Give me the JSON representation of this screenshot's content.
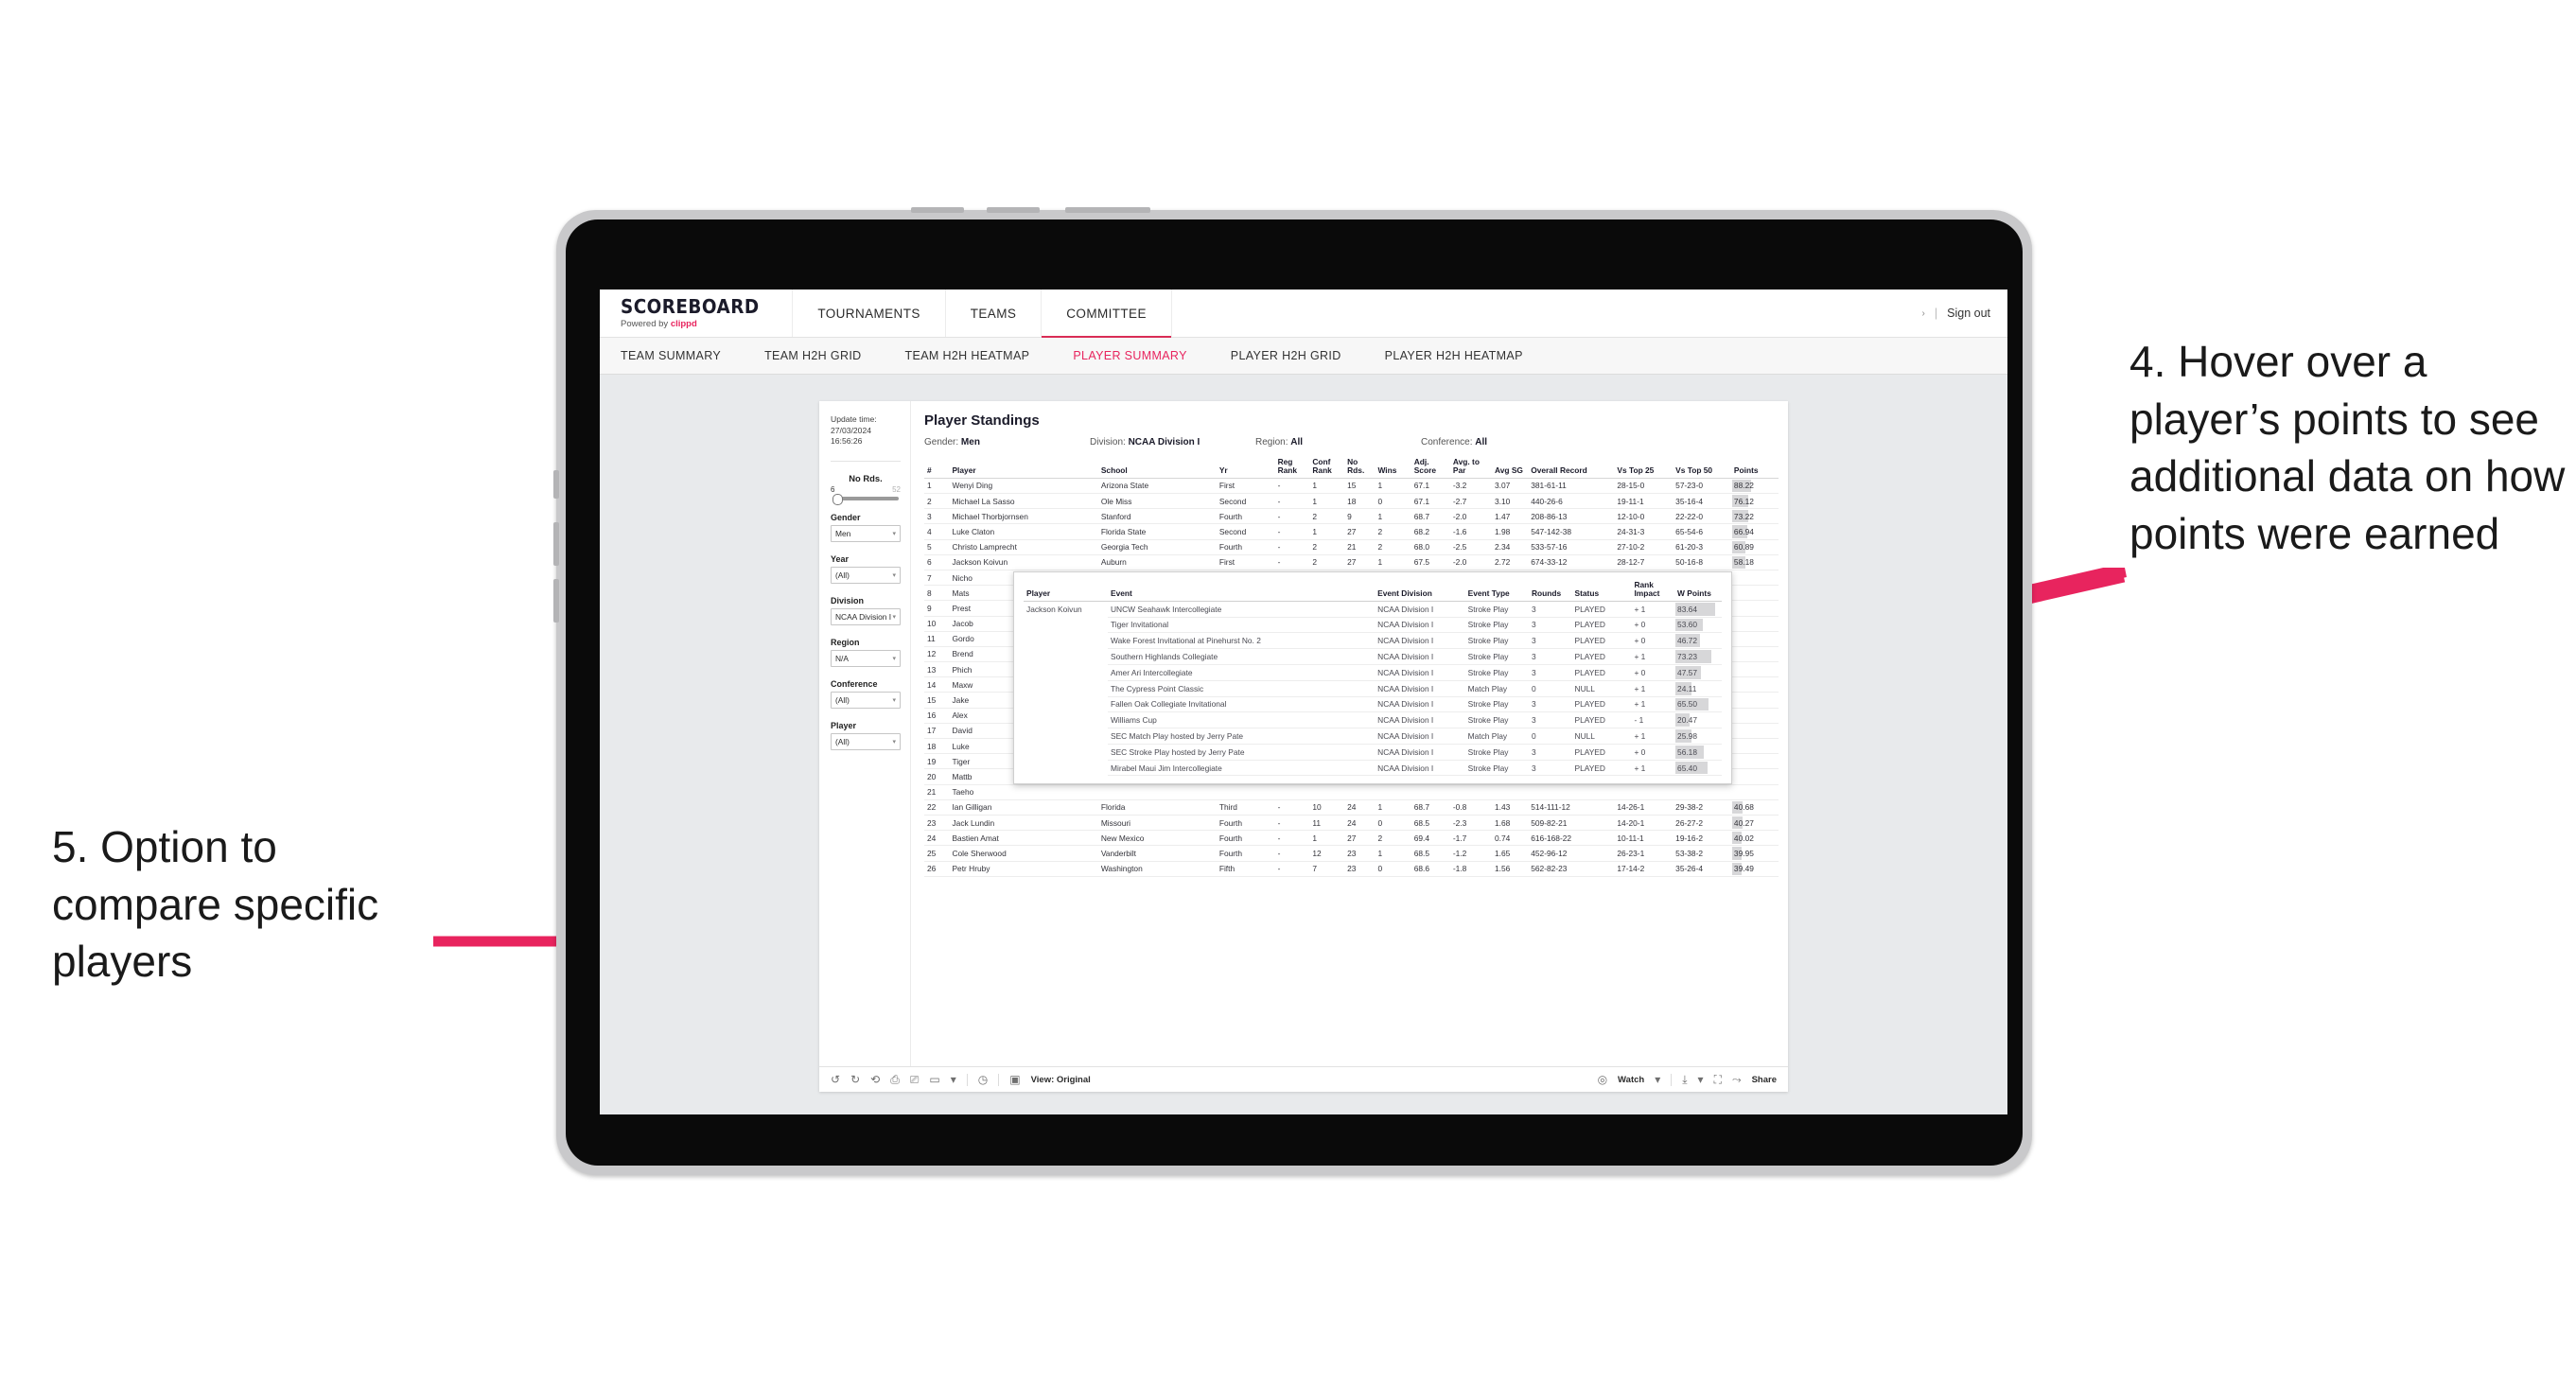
{
  "annotations": {
    "right": "4. Hover over a player’s points to see additional data on how points were earned",
    "left": "5. Option to compare specific players",
    "arrow_color": "#e8245e"
  },
  "appbar": {
    "brand_title": "SCOREBOARD",
    "brand_sub_prefix": "Powered by ",
    "brand_sub_name": "clippd",
    "tabs": [
      {
        "label": "TOURNAMENTS",
        "active": false
      },
      {
        "label": "TEAMS",
        "active": false
      },
      {
        "label": "COMMITTEE",
        "active": true
      }
    ],
    "user_caret": "›",
    "separator": "|",
    "sign_out": "Sign out"
  },
  "subnav": {
    "tabs": [
      {
        "label": "TEAM SUMMARY",
        "active": false
      },
      {
        "label": "TEAM H2H GRID",
        "active": false
      },
      {
        "label": "TEAM H2H HEATMAP",
        "active": false
      },
      {
        "label": "PLAYER SUMMARY",
        "active": true
      },
      {
        "label": "PLAYER H2H GRID",
        "active": false
      },
      {
        "label": "PLAYER H2H HEATMAP",
        "active": false
      }
    ]
  },
  "filters": {
    "update_label": "Update time:",
    "update_value": "27/03/2024 16:56:26",
    "slider": {
      "title": "No Rds.",
      "min": "6",
      "max": "52",
      "knob_pct": 4
    },
    "selects": [
      {
        "label": "Gender",
        "value": "Men"
      },
      {
        "label": "Year",
        "value": "(All)"
      },
      {
        "label": "Division",
        "value": "NCAA Division I"
      },
      {
        "label": "Region",
        "value": "N/A"
      },
      {
        "label": "Conference",
        "value": "(All)"
      },
      {
        "label": "Player",
        "value": "(All)"
      }
    ],
    "caret": "▾"
  },
  "standings": {
    "title": "Player Standings",
    "meta": [
      {
        "label": "Gender:",
        "value": "Men"
      },
      {
        "label": "Division:",
        "value": "NCAA Division I"
      },
      {
        "label": "Region:",
        "value": "All"
      },
      {
        "label": "Conference:",
        "value": "All"
      }
    ],
    "columns": [
      "#",
      "Player",
      "School",
      "Yr",
      "Reg Rank",
      "Conf Rank",
      "No Rds.",
      "Wins",
      "Adj. Score",
      "Avg. to Par",
      "Avg SG",
      "Overall Record",
      "Vs Top 25",
      "Vs Top 50",
      "Points"
    ],
    "rows": [
      [
        "1",
        "Wenyi Ding",
        "Arizona State",
        "First",
        "-",
        "1",
        "15",
        "1",
        "67.1",
        "-3.2",
        "3.07",
        "381-61-11",
        "28-15-0",
        "57-23-0",
        "88.22"
      ],
      [
        "2",
        "Michael La Sasso",
        "Ole Miss",
        "Second",
        "-",
        "1",
        "18",
        "0",
        "67.1",
        "-2.7",
        "3.10",
        "440-26-6",
        "19-11-1",
        "35-16-4",
        "76.12"
      ],
      [
        "3",
        "Michael Thorbjornsen",
        "Stanford",
        "Fourth",
        "-",
        "2",
        "9",
        "1",
        "68.7",
        "-2.0",
        "1.47",
        "208-86-13",
        "12-10-0",
        "22-22-0",
        "73.22"
      ],
      [
        "4",
        "Luke Claton",
        "Florida State",
        "Second",
        "-",
        "1",
        "27",
        "2",
        "68.2",
        "-1.6",
        "1.98",
        "547-142-38",
        "24-31-3",
        "65-54-6",
        "66.94"
      ],
      [
        "5",
        "Christo Lamprecht",
        "Georgia Tech",
        "Fourth",
        "-",
        "2",
        "21",
        "2",
        "68.0",
        "-2.5",
        "2.34",
        "533-57-16",
        "27-10-2",
        "61-20-3",
        "60.89"
      ],
      [
        "6",
        "Jackson Koivun",
        "Auburn",
        "First",
        "-",
        "2",
        "27",
        "1",
        "67.5",
        "-2.0",
        "2.72",
        "674-33-12",
        "28-12-7",
        "50-16-8",
        "58.18"
      ]
    ],
    "hidden_rows": [
      [
        "7",
        "Nicho"
      ],
      [
        "8",
        "Mats"
      ],
      [
        "9",
        "Prest"
      ],
      [
        "10",
        "Jacob"
      ],
      [
        "11",
        "Gordo"
      ],
      [
        "12",
        "Brend"
      ],
      [
        "13",
        "Phich"
      ],
      [
        "14",
        "Maxw"
      ],
      [
        "15",
        "Jake "
      ],
      [
        "16",
        "Alex "
      ],
      [
        "17",
        "David"
      ],
      [
        "18",
        "Luke "
      ],
      [
        "19",
        "Tiger"
      ],
      [
        "20",
        "Mattb"
      ],
      [
        "21",
        "Taeho"
      ]
    ],
    "bottom_rows": [
      [
        "22",
        "Ian Gilligan",
        "Florida",
        "Third",
        "-",
        "10",
        "24",
        "1",
        "68.7",
        "-0.8",
        "1.43",
        "514-111-12",
        "14-26-1",
        "29-38-2",
        "40.68"
      ],
      [
        "23",
        "Jack Lundin",
        "Missouri",
        "Fourth",
        "-",
        "11",
        "24",
        "0",
        "68.5",
        "-2.3",
        "1.68",
        "509-82-21",
        "14-20-1",
        "26-27-2",
        "40.27"
      ],
      [
        "24",
        "Bastien Amat",
        "New Mexico",
        "Fourth",
        "-",
        "1",
        "27",
        "2",
        "69.4",
        "-1.7",
        "0.74",
        "616-168-22",
        "10-11-1",
        "19-16-2",
        "40.02"
      ],
      [
        "25",
        "Cole Sherwood",
        "Vanderbilt",
        "Fourth",
        "-",
        "12",
        "23",
        "1",
        "68.5",
        "-1.2",
        "1.65",
        "452-96-12",
        "26-23-1",
        "53-38-2",
        "39.95"
      ],
      [
        "26",
        "Petr Hruby",
        "Washington",
        "Fifth",
        "-",
        "7",
        "23",
        "0",
        "68.6",
        "-1.8",
        "1.56",
        "562-82-23",
        "17-14-2",
        "35-26-4",
        "39.49"
      ]
    ]
  },
  "tooltip": {
    "columns": [
      "Player",
      "Event",
      "Event Division",
      "Event Type",
      "Rounds",
      "Status",
      "Rank Impact",
      "W Points"
    ],
    "player": "Jackson Koivun",
    "rows": [
      [
        "UNCW Seahawk Intercollegiate",
        "NCAA Division I",
        "Stroke Play",
        "3",
        "PLAYED",
        "+ 1",
        "83.64"
      ],
      [
        "Tiger Invitational",
        "NCAA Division I",
        "Stroke Play",
        "3",
        "PLAYED",
        "+ 0",
        "53.60"
      ],
      [
        "Wake Forest Invitational at Pinehurst No. 2",
        "NCAA Division I",
        "Stroke Play",
        "3",
        "PLAYED",
        "+ 0",
        "46.72"
      ],
      [
        "Southern Highlands Collegiate",
        "NCAA Division I",
        "Stroke Play",
        "3",
        "PLAYED",
        "+ 1",
        "73.23"
      ],
      [
        "Amer Ari Intercollegiate",
        "NCAA Division I",
        "Stroke Play",
        "3",
        "PLAYED",
        "+ 0",
        "47.57"
      ],
      [
        "The Cypress Point Classic",
        "NCAA Division I",
        "Match Play",
        "0",
        "NULL",
        "+ 1",
        "24.11"
      ],
      [
        "Fallen Oak Collegiate Invitational",
        "NCAA Division I",
        "Stroke Play",
        "3",
        "PLAYED",
        "+ 1",
        "65.50"
      ],
      [
        "Williams Cup",
        "NCAA Division I",
        "Stroke Play",
        "3",
        "PLAYED",
        "- 1",
        "20.47"
      ],
      [
        "SEC Match Play hosted by Jerry Pate",
        "NCAA Division I",
        "Match Play",
        "0",
        "NULL",
        "+ 1",
        "25.98"
      ],
      [
        "SEC Stroke Play hosted by Jerry Pate",
        "NCAA Division I",
        "Stroke Play",
        "3",
        "PLAYED",
        "+ 0",
        "56.18"
      ],
      [
        "Mirabel Maui Jim Intercollegiate",
        "NCAA Division I",
        "Stroke Play",
        "3",
        "PLAYED",
        "+ 1",
        "65.40"
      ]
    ]
  },
  "viz_toolbar": {
    "undo": "↺",
    "redo": "↻",
    "revert": "⟲",
    "refresh": "⎙",
    "pause": "⎚",
    "view_icon": "▭",
    "caret": "▾",
    "divider": "|",
    "clock": "◷",
    "view_badge": "▣",
    "view_label": "View: Original",
    "watch_icon": "◎",
    "watch_label": "Watch",
    "download_icon": "⤓",
    "fullscreen_icon": "⛶",
    "share_icon": "⤳",
    "share_label": "Share"
  }
}
